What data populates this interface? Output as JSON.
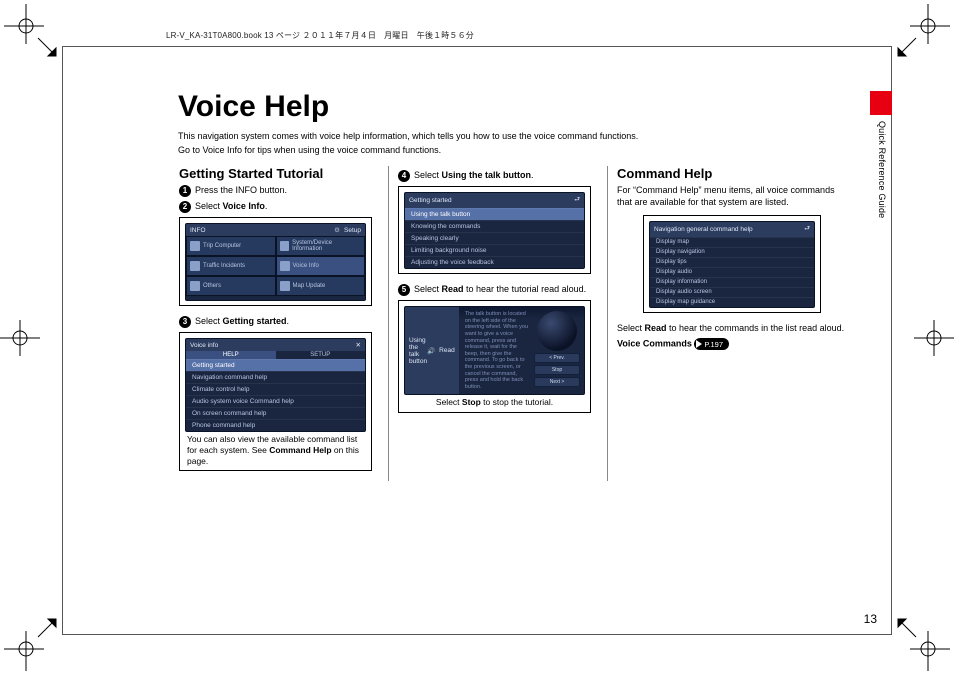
{
  "running_head": "LR-V_KA-31T0A800.book  13 ページ  ２０１１年７月４日　月曜日　午後１時５６分",
  "title": "Voice Help",
  "intro1": "This navigation system comes with voice help information, which tells you how to use the voice command functions.",
  "intro2": "Go to Voice Info for tips when using the voice command functions.",
  "side_label": "Quick Reference Guide",
  "page_number": "13",
  "tutorial_heading": "Getting Started Tutorial",
  "cmdhelp_heading": "Command Help",
  "step1": {
    "text_a": "Press the INFO button."
  },
  "step2": {
    "text_a": "Select ",
    "bold": "Voice Info",
    "text_b": "."
  },
  "info_header": "INFO",
  "info_setup": "Setup",
  "info_cells": [
    "Trip Computer",
    "System/Device Information",
    "Traffic Incidents",
    "Voice Info",
    "Others",
    "Map Update"
  ],
  "step3": {
    "text_a": "Select ",
    "bold": "Getting started",
    "text_b": "."
  },
  "voice_info_header": "Voice info",
  "voice_tabs": {
    "left": "HELP",
    "right": "SETUP"
  },
  "voice_rows": [
    "Getting started",
    "Navigation command help",
    "Climate control help",
    "Audio system voice Command help",
    "On screen command help",
    "Phone command help"
  ],
  "voice_caption": {
    "a": "You can also view the available command list for each system. See ",
    "b": "Command Help",
    "c": " on this page."
  },
  "step4": {
    "text_a": "Select ",
    "bold": "Using the talk button",
    "text_b": "."
  },
  "gs_header": "Getting started",
  "gs_rows": [
    "Using the talk button",
    "Knowing the commands",
    "Speaking clearly",
    "Limiting background noise",
    "Adjusting the voice feedback"
  ],
  "step5": {
    "text_a": "Select ",
    "bold": "Read",
    "text_b": " to hear the tutorial read aloud."
  },
  "talk_header": "Using the talk button",
  "talk_read": "Read",
  "talk_body": "The talk button is located on the left side of the steering wheel. When you want to give a voice command, press and release it, wait for the beep, then give the command. To go back to the previous screen, or cancel the command, press and hold the back button.",
  "talk_btns": [
    "< Prev.",
    "Stop",
    "Next >"
  ],
  "talk_caption": {
    "a": "Select ",
    "b": "Stop",
    "c": " to stop the tutorial."
  },
  "cmd_intro": "For “Command Help” menu items, all voice commands that are available for that system are listed.",
  "cmd_header": "Navigation general command help",
  "cmd_rows": [
    "Display map",
    "Display navigation",
    "Display tips",
    "Display audio",
    "Display information",
    "Display audio screen",
    "Display map guidance"
  ],
  "cmd_caption": {
    "a": "Select ",
    "b": "Read",
    "c": " to hear the commands in the list read aloud."
  },
  "voice_commands_label": "Voice Commands",
  "pill_text": "P.197"
}
